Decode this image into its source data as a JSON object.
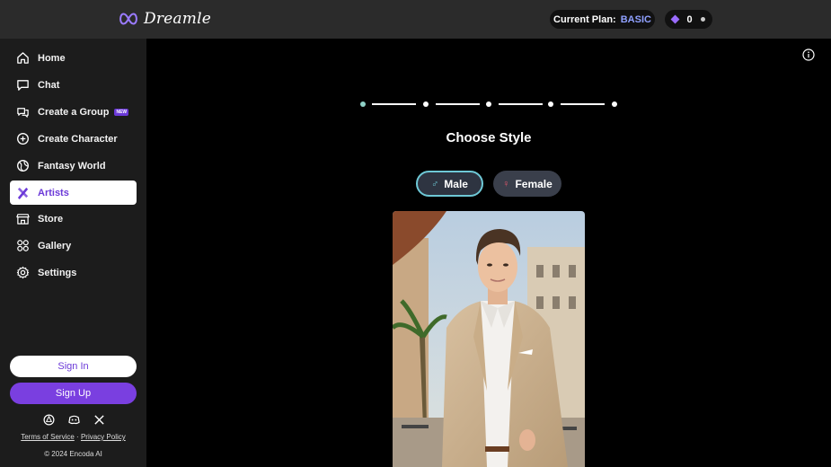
{
  "header": {
    "logo_text": "Dreamle",
    "plan_label": "Current Plan:",
    "plan_value": "BASIC",
    "credits": "0"
  },
  "sidebar": {
    "items": [
      {
        "label": "Home",
        "icon": "home-icon"
      },
      {
        "label": "Chat",
        "icon": "chat-icon"
      },
      {
        "label": "Create a Group",
        "icon": "group-icon",
        "badge": "NEW"
      },
      {
        "label": "Create Character",
        "icon": "plus-circle-icon"
      },
      {
        "label": "Fantasy World",
        "icon": "globe-icon"
      },
      {
        "label": "Artists",
        "icon": "brush-icon",
        "active": true
      },
      {
        "label": "Store",
        "icon": "store-icon"
      },
      {
        "label": "Gallery",
        "icon": "gallery-icon"
      },
      {
        "label": "Settings",
        "icon": "gear-icon"
      }
    ],
    "sign_in": "Sign In",
    "sign_up": "Sign Up",
    "socials": [
      "reddit-icon",
      "discord-icon",
      "x-icon"
    ],
    "terms": "Terms of Service",
    "separator": "·",
    "privacy": "Privacy Policy",
    "copyright": "© 2024 Encoda AI"
  },
  "main": {
    "title": "Choose Style",
    "steps_total": 5,
    "current_step": 1,
    "male_label": "Male",
    "female_label": "Female",
    "selected_gender": "Male"
  },
  "colors": {
    "accent": "#7a3fe0",
    "active_text": "#6b39d8",
    "selected_border": "#6ec8d6",
    "plan_value": "#8fa0ff"
  }
}
